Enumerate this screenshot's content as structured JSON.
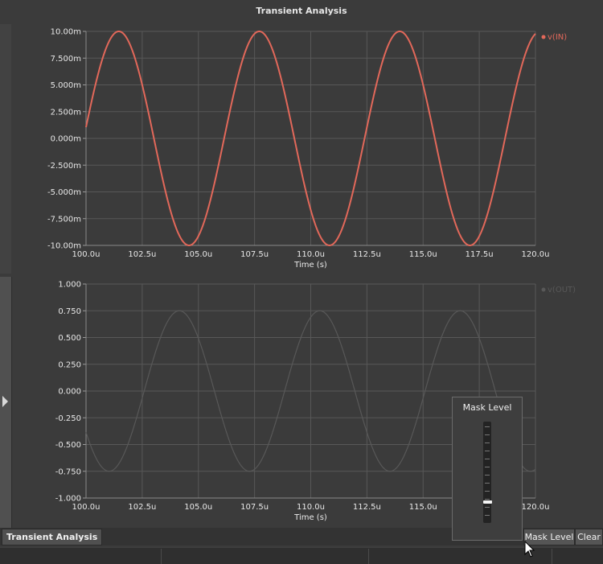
{
  "window": {
    "title": "Transient Analysis"
  },
  "tabs": [
    {
      "label": "Transient Analysis"
    }
  ],
  "toolbar": {
    "mask_level_label": "Mask Level",
    "clear_label": "Clear"
  },
  "mask_popup": {
    "title": "Mask Level",
    "level": 0.18
  },
  "colors": {
    "vin": "#e2685a",
    "vout": "#585858",
    "grid": "#585858",
    "plot_bg": "#3b3b3b"
  },
  "chart_data": [
    {
      "type": "line",
      "xlabel": "Time (s)",
      "ylabel": "",
      "xlim": [
        100.0,
        120.0
      ],
      "ylim": [
        -10.0,
        10.0
      ],
      "x_ticks": [
        "100.0u",
        "102.5u",
        "105.0u",
        "107.5u",
        "110.0u",
        "112.5u",
        "115.0u",
        "117.5u",
        "120.0u"
      ],
      "y_ticks": [
        "10.00m",
        "7.500m",
        "5.000m",
        "2.500m",
        "0.000m",
        "-2.500m",
        "-5.000m",
        "-7.500m",
        "-10.00m"
      ],
      "grid": true,
      "legend": "top-right",
      "series": [
        {
          "name": "v(IN)",
          "amplitude": 10.0,
          "period": 6.25,
          "phase_deg": 6,
          "x_units": "us",
          "y_units": "mV"
        }
      ]
    },
    {
      "type": "line",
      "xlabel": "Time (s)",
      "ylabel": "",
      "xlim": [
        100.0,
        120.0
      ],
      "ylim": [
        -1.0,
        1.0
      ],
      "x_ticks": [
        "100.0u",
        "102.5u",
        "105.0u",
        "107.5u",
        "110.0u",
        "112.5u",
        "115.0u",
        "117.5u",
        "120.0u"
      ],
      "y_ticks": [
        "1.000",
        "0.750",
        "0.500",
        "0.250",
        "0.000",
        "-0.250",
        "-0.500",
        "-0.750",
        "-1.000"
      ],
      "grid": true,
      "legend": "top-right",
      "series": [
        {
          "name": "v(OUT)",
          "amplitude": 0.75,
          "period": 6.25,
          "peak_at": 104.15,
          "x_units": "us",
          "y_units": "V"
        }
      ]
    }
  ]
}
